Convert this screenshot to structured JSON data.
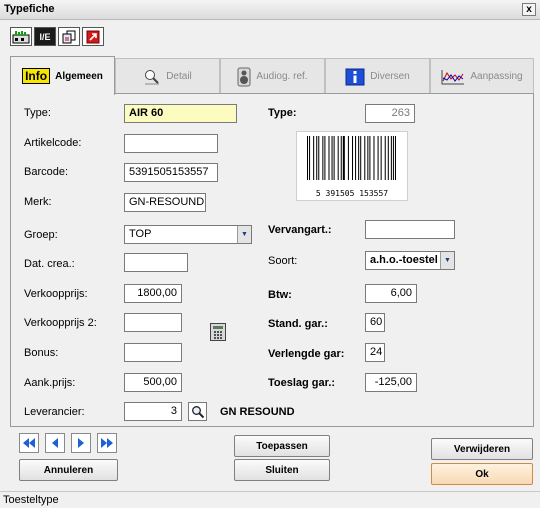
{
  "window": {
    "title": "Typefiche",
    "close": "x"
  },
  "toolbar": {
    "btn2_text": "I/E"
  },
  "tabs": [
    {
      "label": "Algemeen",
      "logo": "Info"
    },
    {
      "label": "Detail"
    },
    {
      "label": "Audiog. ref."
    },
    {
      "label": "Diversen"
    },
    {
      "label": "Aanpassing"
    }
  ],
  "form": {
    "type_label": "Type:",
    "type_value": "AIR 60",
    "type2_label": "Type:",
    "type2_value": "263",
    "artikelcode_label": "Artikelcode:",
    "artikelcode_value": "",
    "barcode_label": "Barcode:",
    "barcode_value": "5391505153557",
    "barcode_digits": "5  391505  153557",
    "merk_label": "Merk:",
    "merk_value": "GN-RESOUND",
    "groep_label": "Groep:",
    "groep_value": "TOP",
    "vervangart_label": "Vervangart.:",
    "vervangart_value": "",
    "datcrea_label": "Dat. crea.:",
    "datcrea_value": "",
    "soort_label": "Soort:",
    "soort_value": "a.h.o.-toestel",
    "verkoopprijs_label": "Verkoopprijs:",
    "verkoopprijs_value": "1800,00",
    "btw_label": "Btw:",
    "btw_value": "6,00",
    "verkoopprijs2_label": "Verkoopprijs 2:",
    "verkoopprijs2_value": "",
    "standgar_label": "Stand. gar.:",
    "standgar_value": "60",
    "bonus_label": "Bonus:",
    "bonus_value": "",
    "verlengdegar_label": "Verlengde gar:",
    "verlengdegar_value": "24",
    "aankprijs_label": "Aank.prijs:",
    "aankprijs_value": "500,00",
    "toeslaggar_label": "Toeslag gar.:",
    "toeslaggar_value": "-125,00",
    "leverancier_label": "Leverancier:",
    "leverancier_value": "3",
    "leverancier_name": "GN RESOUND"
  },
  "buttons": {
    "annuleren": "Annuleren",
    "toepassen": "Toepassen",
    "sluiten": "Sluiten",
    "verwijderen": "Verwijderen",
    "ok": "Ok"
  },
  "status": {
    "text": "Toesteltype"
  },
  "colors": {
    "nav_arrow": "#1f5fd8",
    "info_logo": "#f7e600",
    "ok_bg": "#f8dab6",
    "type_bg": "#fdfcc0"
  }
}
